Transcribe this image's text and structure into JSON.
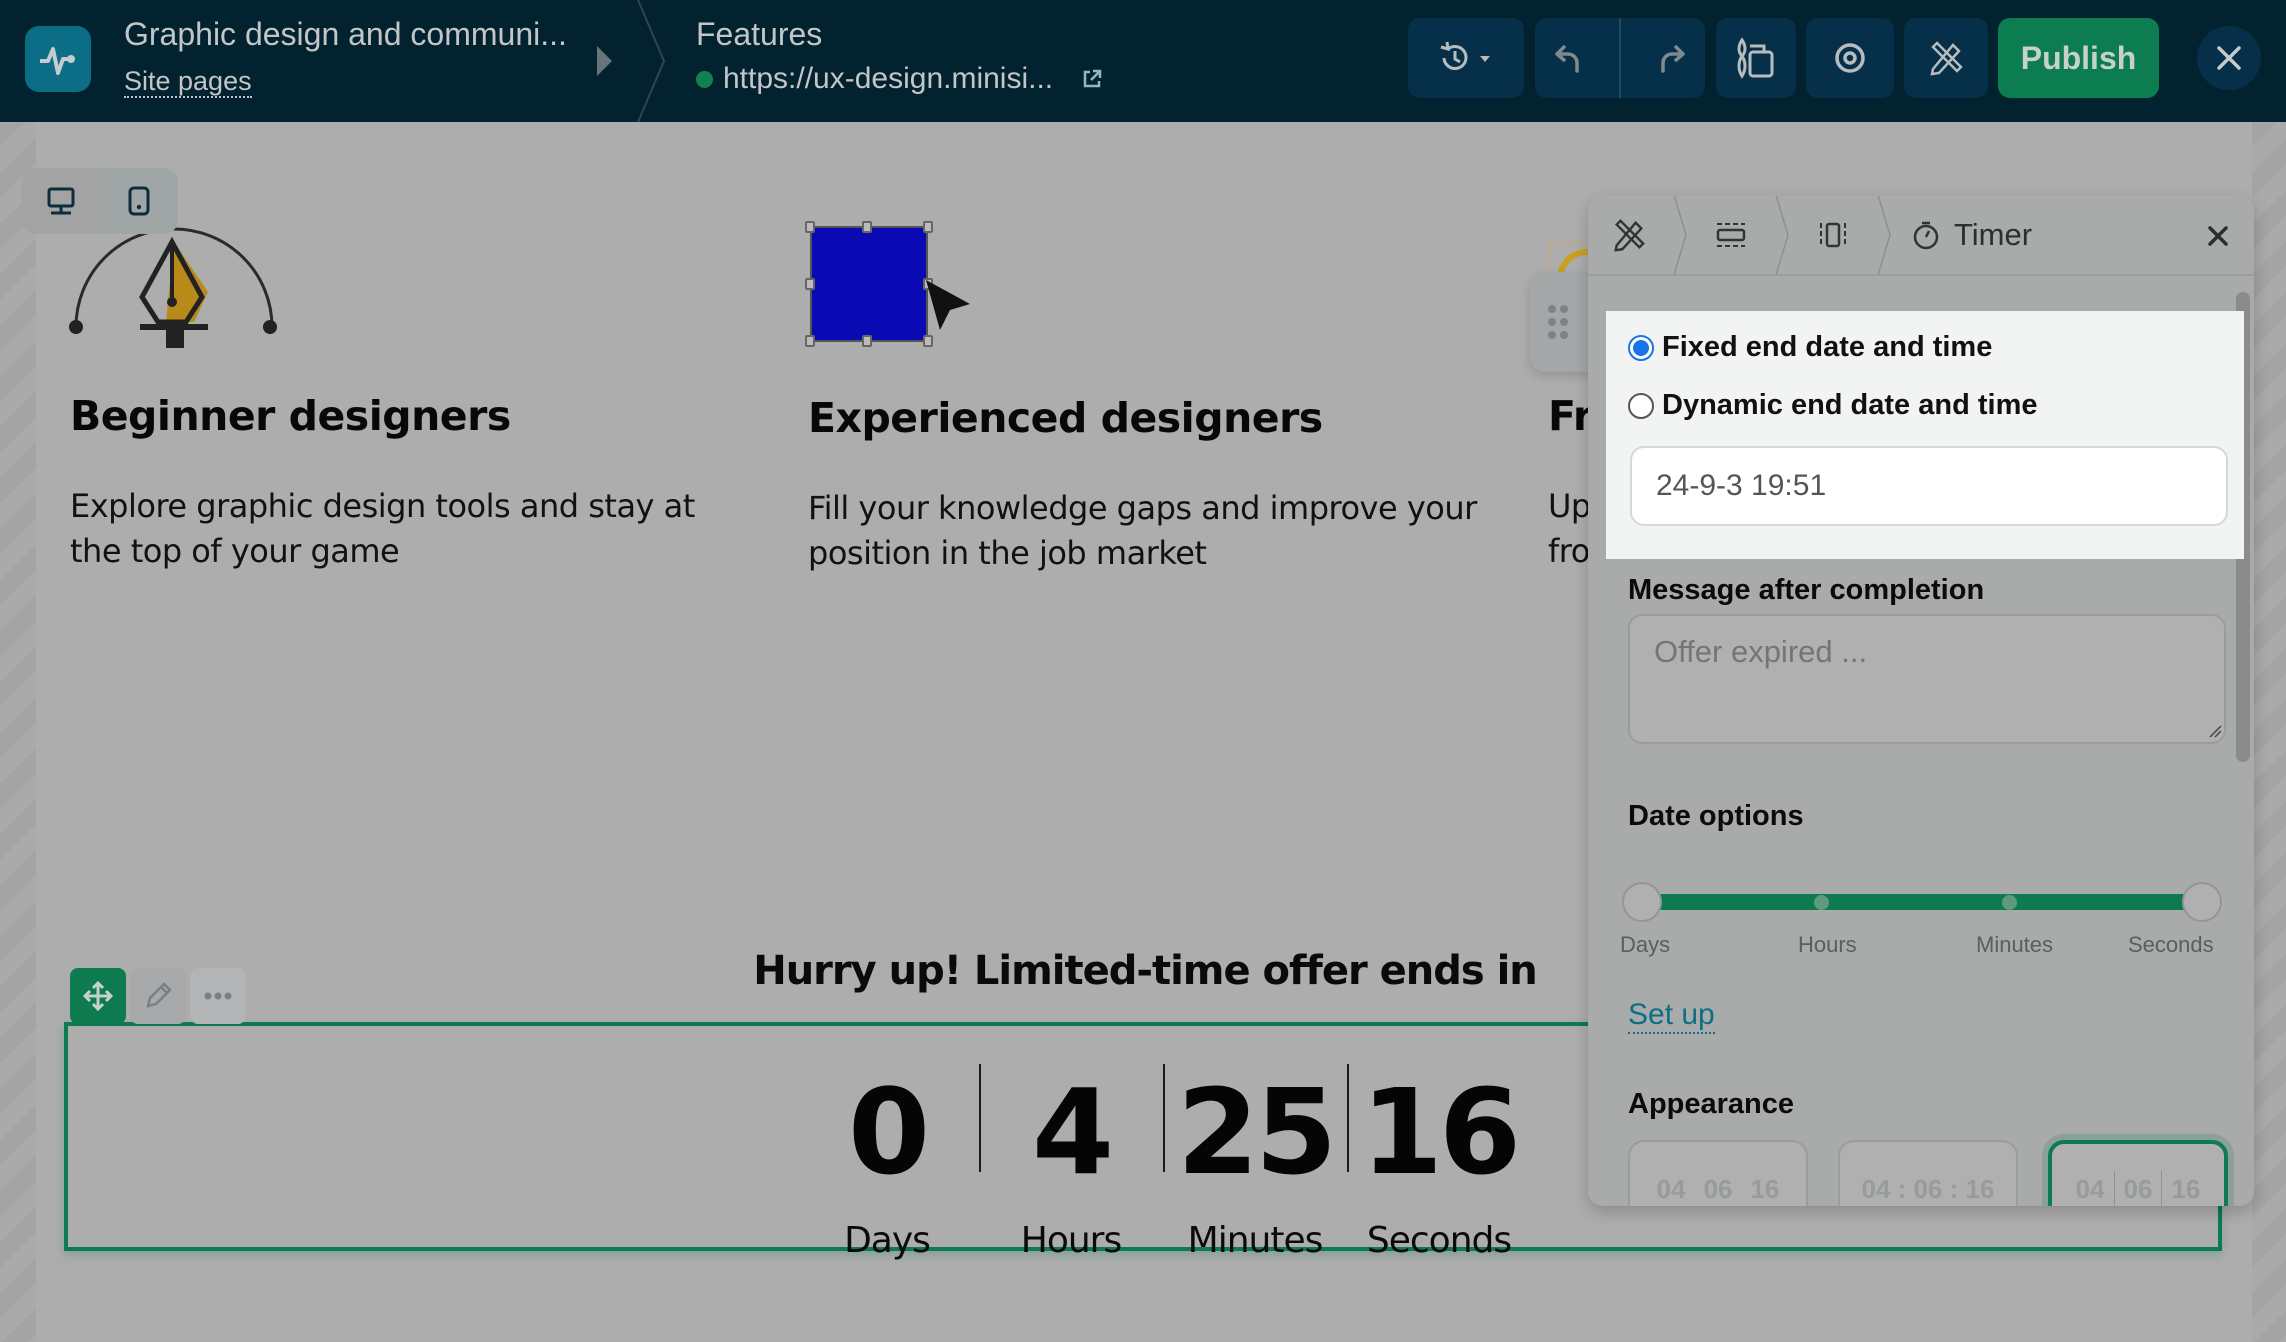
{
  "topbar": {
    "site_title": "Graphic design and communi...",
    "site_pages_link": "Site pages",
    "page_name": "Features",
    "page_url": "https://ux-design.minisi...",
    "publish_label": "Publish",
    "icons": [
      "pulse-logo-icon",
      "history-icon",
      "undo-icon",
      "redo-icon",
      "style-icon",
      "preview-eye-icon",
      "design-tools-icon",
      "close-icon"
    ]
  },
  "device_toggle": {
    "options": [
      "desktop",
      "mobile"
    ],
    "selected": "desktop"
  },
  "features": [
    {
      "title": "Beginner designers",
      "description": "Explore graphic design tools and stay at the top of your game",
      "icon": "pen-tool-icon"
    },
    {
      "title": "Experienced designers",
      "description": "Fill your knowledge gaps and improve your position in the job market",
      "icon": "selection-box-icon"
    },
    {
      "title": "Fr",
      "description_line1": "Up",
      "description_line2": "fro",
      "icon": "partial-icon"
    }
  ],
  "timer_block": {
    "heading": "Hurry up! Limited-time offer ends in",
    "units": [
      {
        "value": "0",
        "label": "Days"
      },
      {
        "value": "4",
        "label": "Hours"
      },
      {
        "value": "25",
        "label": "Minutes"
      },
      {
        "value": "16",
        "label": "Seconds"
      }
    ]
  },
  "panel": {
    "title": "Timer",
    "breadcrumb_icons": [
      "design-tools-icon",
      "section-icon",
      "column-icon",
      "stopwatch-icon"
    ],
    "end_mode": {
      "options": [
        "Fixed end date and time",
        "Dynamic end date and time"
      ],
      "selected": "Fixed end date and time"
    },
    "end_datetime_value": "24-9-3 19:51",
    "message_label": "Message after completion",
    "message_placeholder": "Offer expired ...",
    "date_options_label": "Date options",
    "date_options": {
      "stops": [
        "Days",
        "Hours",
        "Minutes",
        "Seconds"
      ],
      "range_start": "Days",
      "range_end": "Seconds"
    },
    "setup_link": "Set up",
    "appearance_label": "Appearance",
    "appearance_options": [
      {
        "style": "plain",
        "parts": [
          "04",
          "06",
          "16"
        ]
      },
      {
        "style": "colon",
        "text": "04 : 06 : 16"
      },
      {
        "style": "divided",
        "parts": [
          "04",
          "06",
          "16"
        ]
      }
    ],
    "appearance_selected": "divided"
  },
  "colors": {
    "topbar_bg": "#03222f",
    "accent_green": "#0d7a50",
    "link_teal": "#0d6f86",
    "radio_blue": "#1a73e8",
    "selection_blue": "#0a0ab4"
  }
}
